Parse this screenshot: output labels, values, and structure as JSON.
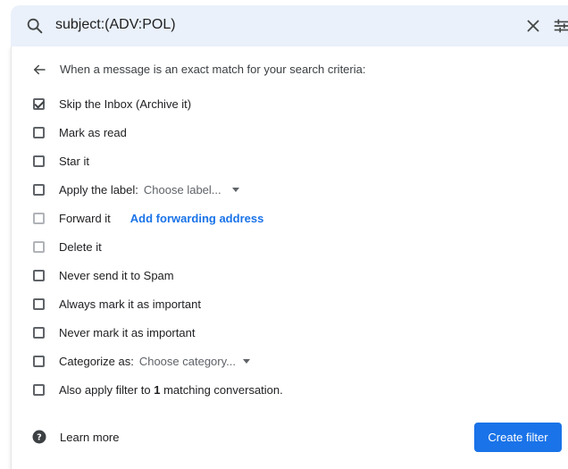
{
  "search": {
    "query": "subject:(ADV:POL)"
  },
  "panel": {
    "header": "When a message is an exact match for your search criteria:",
    "options": [
      {
        "label": "Skip the Inbox (Archive it)",
        "checked": true
      },
      {
        "label": "Mark as read",
        "checked": false
      },
      {
        "label": "Star it",
        "checked": false
      },
      {
        "label": "Apply the label:",
        "checked": false,
        "select_value": "Choose label..."
      },
      {
        "label": "Forward it",
        "checked": false,
        "disabled": true,
        "link": "Add forwarding address"
      },
      {
        "label": "Delete it",
        "checked": false,
        "disabled": true
      },
      {
        "label": "Never send it to Spam",
        "checked": false
      },
      {
        "label": "Always mark it as important",
        "checked": false
      },
      {
        "label": "Never mark it as important",
        "checked": false
      },
      {
        "label": "Categorize as:",
        "checked": false,
        "select_value": "Choose category..."
      },
      {
        "label_prefix": "Also apply filter to ",
        "count": "1",
        "label_suffix": " matching conversation.",
        "checked": false
      }
    ],
    "learn_more": "Learn more",
    "create_button": "Create filter"
  },
  "icons": {
    "search": "search-icon",
    "clear": "close-icon",
    "tune": "tune-icon",
    "back": "arrow-back-icon",
    "help": "help-icon"
  },
  "colors": {
    "search_bg": "#eaf1fb",
    "accent": "#1a73e8"
  }
}
